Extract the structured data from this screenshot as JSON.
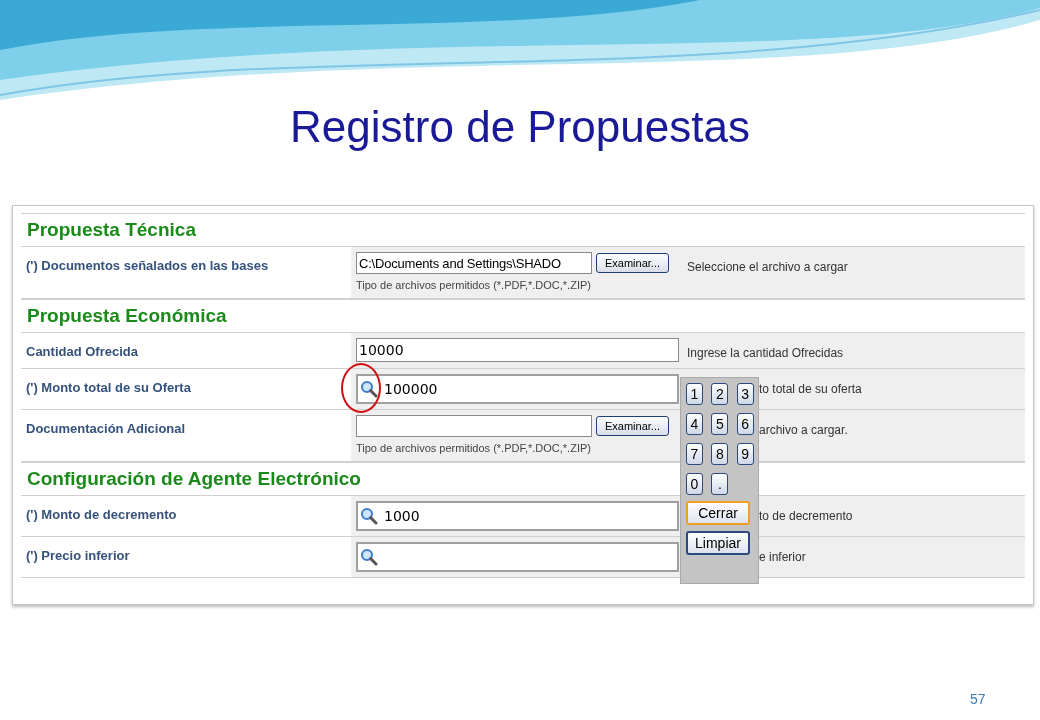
{
  "title": "Registro de Propuestas",
  "sections": [
    {
      "heading": "Propuesta Técnica",
      "rows": [
        {
          "kind": "file",
          "label": "(') Documentos señalados en las bases",
          "value": "C:\\Documents and Settings\\SHADO",
          "button": "Examinar...",
          "note": "Tipo de archivos permitidos (*.PDF,*.DOC,*.ZIP)",
          "hint": "Seleccione el archivo a cargar",
          "hint_under_keypad": false
        }
      ]
    },
    {
      "heading": "Propuesta Económica",
      "rows": [
        {
          "kind": "text",
          "label": "Cantidad Ofrecida",
          "value": "10000",
          "hint": "Ingrese la cantidad Ofrecidas",
          "hint_under_keypad": false
        },
        {
          "kind": "search",
          "label": "(') Monto total de su Oferta",
          "value": "100000",
          "circled": true,
          "hint": "to total de su oferta",
          "hint_under_keypad": true
        },
        {
          "kind": "file",
          "label": "Documentación Adicional",
          "value": "",
          "button": "Examinar...",
          "note": "Tipo de archivos permitidos (*.PDF,*.DOC,*.ZIP)",
          "hint": "archivo a cargar.",
          "hint_under_keypad": true
        }
      ]
    },
    {
      "heading": "Configuración de Agente Electrónico",
      "rows": [
        {
          "kind": "search",
          "label": "(') Monto de decremento",
          "value": "1000",
          "circled": false,
          "hint": "to de decremento",
          "hint_under_keypad": true
        },
        {
          "kind": "search",
          "label": "(') Precio inferior",
          "value": "",
          "circled": false,
          "hint": "e inferior",
          "hint_under_keypad": true
        }
      ]
    }
  ],
  "keypad": {
    "keys": [
      "1",
      "2",
      "3",
      "4",
      "5",
      "6",
      "7",
      "8",
      "9",
      "0",
      "."
    ],
    "buttons": [
      {
        "label": "Cerrar",
        "focused": true
      },
      {
        "label": "Limpiar",
        "focused": false
      }
    ]
  },
  "page_number": "57"
}
